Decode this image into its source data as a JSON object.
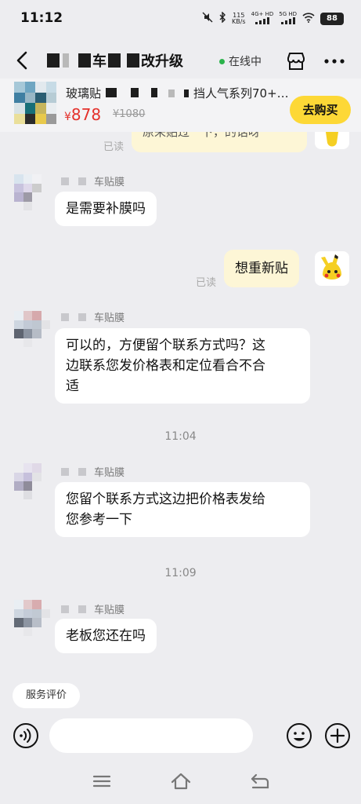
{
  "status_bar": {
    "time": "11:12",
    "net_speed_top": "115",
    "net_speed_bottom": "KB/s",
    "sig1": "4G+ HD",
    "sig2": "5G HD",
    "battery": "88"
  },
  "header": {
    "title_visible": "车贴膜改升级",
    "title_part1": "车",
    "title_part2": "改升级",
    "online_label": "在线中"
  },
  "product": {
    "title": "玻璃贴...挡人气系列70+...",
    "title_left": "玻璃贴",
    "title_right": "挡人气系列70+…",
    "currency": "¥",
    "price": "878",
    "original_price": "¥1080",
    "buy_label": "去购买"
  },
  "chat": {
    "top_partial": {
      "read": "已读",
      "text": "原来贴过一下，的话呀"
    },
    "messages": [
      {
        "sender_suffix": "车贴膜",
        "text": "是需要补膜吗"
      },
      {
        "read": "已读",
        "text": "想重新贴"
      },
      {
        "sender_suffix": "车贴膜",
        "text_line1": "可以的，方便留个联系方式吗？这",
        "text_line2": "边联系您发价格表和定位看合不合",
        "text_line3": "适"
      },
      {
        "time": "11:04"
      },
      {
        "sender_suffix": "车贴膜",
        "text_line1": "您留个联系方式这边把价格表发给",
        "text_line2": "您参考一下"
      },
      {
        "time": "11:09"
      },
      {
        "sender_suffix": "车贴膜",
        "text": "老板您还在吗"
      }
    ]
  },
  "bottom": {
    "service_chip": "服务评价",
    "input_placeholder": ""
  },
  "icons": {
    "back": "back-arrow-icon",
    "shop": "shop-icon",
    "more": "more-icon",
    "voice": "voice-icon",
    "emoji": "emoji-icon",
    "plus": "plus-icon",
    "nav_menu": "menu-icon",
    "nav_home": "home-icon",
    "nav_back": "nav-back-icon"
  },
  "colors": {
    "accent": "#fdd836",
    "price": "#e4312b",
    "online": "#2bb34b",
    "bubble_out": "#fdf6d6"
  }
}
